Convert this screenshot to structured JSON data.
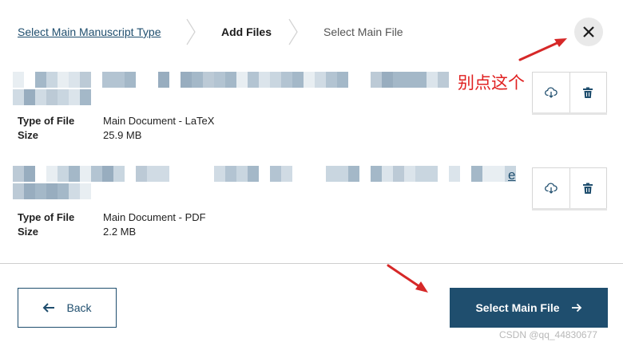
{
  "stepper": {
    "steps": [
      {
        "label": "Select Main Manuscript Type",
        "state": "link"
      },
      {
        "label": "Add Files",
        "state": "current"
      },
      {
        "label": "Select Main File",
        "state": "upcoming"
      }
    ],
    "close_icon": "close-icon"
  },
  "files": [
    {
      "name": "",
      "type_label": "Type of File",
      "type_value": "Main Document - LaTeX",
      "size_label": "Size",
      "size_value": "25.9 MB",
      "actions": [
        "download-icon",
        "trash-icon"
      ]
    },
    {
      "name": "",
      "name_tail": "e",
      "type_label": "Type of File",
      "type_value": "Main Document - PDF",
      "size_label": "Size",
      "size_value": "2.2 MB",
      "actions": [
        "download-icon",
        "trash-icon"
      ]
    }
  ],
  "annotation": {
    "text": "别点这个",
    "color": "#e02020"
  },
  "footer": {
    "back_label": "Back",
    "primary_label": "Select Main File"
  },
  "watermark": "CSDN @qq_44830677",
  "colors": {
    "brand": "#1f4e6e",
    "annotation": "#e02020",
    "close_bg": "#e9e9e9"
  }
}
